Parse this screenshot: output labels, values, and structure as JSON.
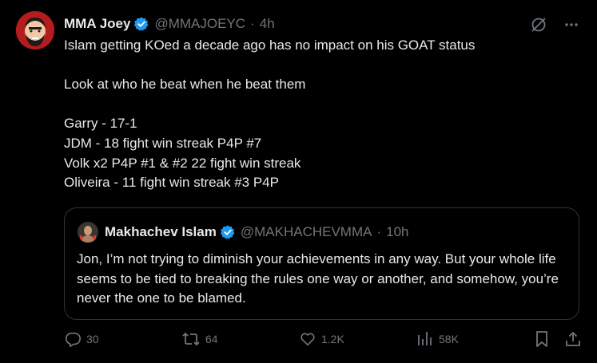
{
  "post": {
    "author_name": "MMA Joey",
    "handle": "@MMAJOEYC",
    "separator": "·",
    "time": "4h",
    "lines": [
      "Islam getting KOed a decade ago has no impact on his GOAT status",
      "Look at who he beat when he beat them",
      "Garry - 17-1",
      "JDM - 18 fight win streak P4P #7",
      "Volk x2 P4P #1 & #2 22 fight win streak",
      "Oliveira - 11 fight win streak #3 P4P"
    ]
  },
  "quote": {
    "author_name": "Makhachev Islam",
    "handle": "@MAKHACHEVMMA",
    "separator": "·",
    "time": "10h",
    "text": "Jon, I’m not trying to diminish your achievements in any way. But your whole life seems to be tied to breaking the rules one way or another, and somehow, you’re never the one to be blamed."
  },
  "actions": {
    "replies": "30",
    "reposts": "64",
    "likes": "1.2K",
    "views": "58K"
  },
  "colors": {
    "background": "#000000",
    "text": "#e7e9ea",
    "muted": "#71767b",
    "verified": "#1d9bf0",
    "border": "#2f3336"
  },
  "icons": [
    "grok-icon",
    "more-icon",
    "reply-icon",
    "repost-icon",
    "like-icon",
    "views-icon",
    "bookmark-icon",
    "share-icon",
    "verified-badge-icon"
  ]
}
